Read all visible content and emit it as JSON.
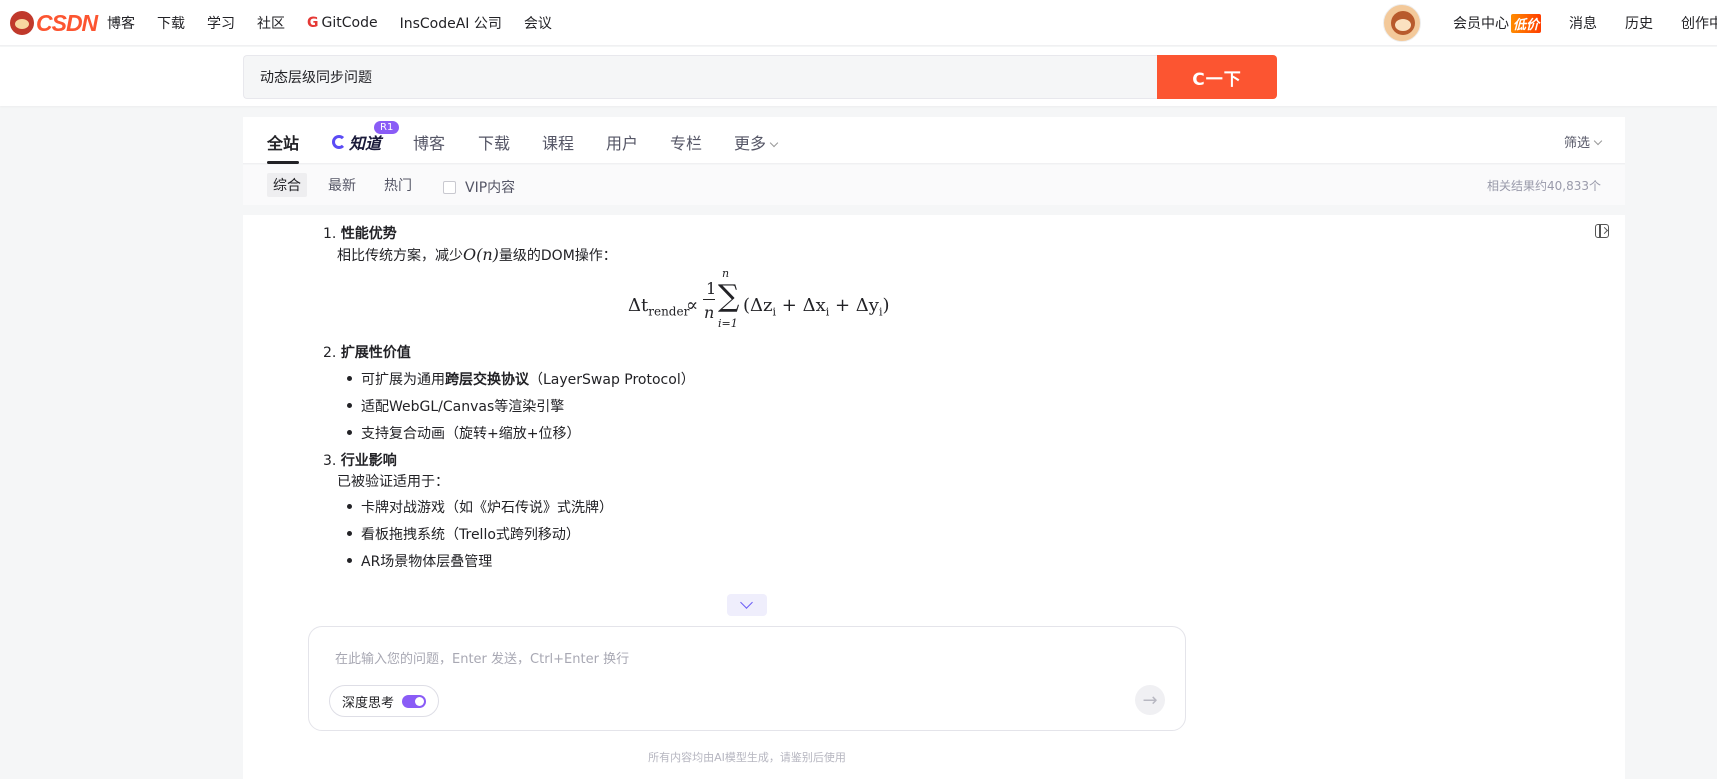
{
  "topnav": {
    "logo_text": "CSDN",
    "items": [
      "博客",
      "下载",
      "学习",
      "社区",
      "GitCode",
      "InsCodeAI 公司",
      "会议"
    ],
    "right": {
      "vip_center": "会员中心",
      "vip_badge": "低价",
      "messages": "消息",
      "history": "历史",
      "create": "创作中心"
    }
  },
  "search": {
    "query": "动态层级同步问题",
    "button_label": "C一下"
  },
  "tabs": {
    "items": [
      "全站",
      "知道",
      "博客",
      "下载",
      "课程",
      "用户",
      "专栏",
      "更多"
    ],
    "zhidao_badge": "R1",
    "filter_label": "筛选"
  },
  "subtabs": {
    "items": [
      "综合",
      "最新",
      "热门"
    ],
    "vip_label": "VIP内容",
    "result_count": "相关结果约40,833个"
  },
  "answer": {
    "sections": [
      {
        "number": "1.",
        "title": "性能优势",
        "text_before": "相比传统方案，减少",
        "math": "O(n)",
        "text_after": "量级的DOM操作："
      },
      {
        "number": "2.",
        "title": "扩展性价值",
        "bullets": [
          {
            "pre": "可扩展为通用",
            "bold": "跨层交换协议",
            "post": "（LayerSwap Protocol）"
          },
          {
            "pre": "适配WebGL/Canvas等渲染引擎",
            "bold": "",
            "post": ""
          },
          {
            "pre": "支持复合动画（旋转+缩放+位移）",
            "bold": "",
            "post": ""
          }
        ]
      },
      {
        "number": "3.",
        "title": "行业影响",
        "intro": "已被验证适用于：",
        "bullets": [
          "卡牌对战游戏（如《炉石传说》式洗牌）",
          "看板拖拽系统（Trello式跨列移动）",
          "AR场景物体层叠管理"
        ]
      }
    ],
    "formula": {
      "lhs": "Δt",
      "lhs_sub": "render",
      "rel": "∝",
      "frac_num": "1",
      "frac_den": "n",
      "sum_top": "n",
      "sum_bottom": "i=1",
      "body": "(Δz",
      "body_sub": "i",
      "body_rest": " + Δx",
      "body_rest_sub": "i",
      "body_end": " + Δy",
      "body_end_sub": "i",
      "close": ")"
    }
  },
  "ask": {
    "placeholder": "在此输入您的问题，Enter 发送，Ctrl+Enter 换行",
    "deep_think_label": "深度思考",
    "disclaimer": "所有内容均由AI模型生成，请鉴别后使用"
  },
  "colors": {
    "brand": "#fc5531",
    "accent_purple": "#8a5cf6"
  }
}
